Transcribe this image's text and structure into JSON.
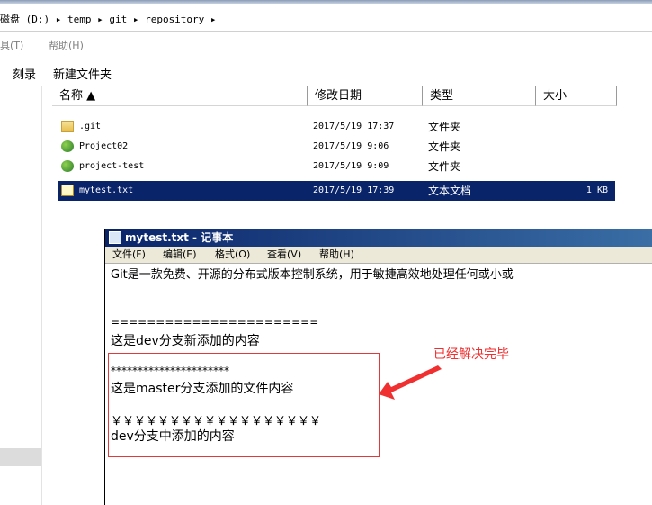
{
  "address_bar": {
    "path": "磁盘 (D:) ▸ temp ▸ git ▸ repository ▸"
  },
  "menu": {
    "tools": "具(T)",
    "help": "帮助(H)"
  },
  "toolbar": {
    "burn": "刻录",
    "new_folder": "新建文件夹"
  },
  "columns": {
    "name": "名称 ▲",
    "modified": "修改日期",
    "type": "类型",
    "size": "大小"
  },
  "files": [
    {
      "name": ".git",
      "modified": "2017/5/19 17:37",
      "type": "文件夹",
      "size": "",
      "icon": "folder-icon"
    },
    {
      "name": "Project02",
      "modified": "2017/5/19 9:06",
      "type": "文件夹",
      "size": "",
      "icon": "git-folder-icon"
    },
    {
      "name": "project-test",
      "modified": "2017/5/19 9:09",
      "type": "文件夹",
      "size": "",
      "icon": "git-folder-icon"
    },
    {
      "name": "mytest.txt",
      "modified": "2017/5/19 17:39",
      "type": "文本文档",
      "size": "1 KB",
      "icon": "text-file-icon",
      "selected": true
    }
  ],
  "notepad": {
    "title": "mytest.txt - 记事本",
    "menu": [
      "文件(F)",
      "编辑(E)",
      "格式(O)",
      "查看(V)",
      "帮助(H)"
    ],
    "lines": [
      "Git是一款免费、开源的分布式版本控制系统，用于敏捷高效地处理任何或小或",
      "",
      "=======================",
      "这是dev分支新添加的内容",
      "",
      "**********************",
      "这是master分支添加的文件内容",
      "",
      "￥￥￥￥￥￥￥￥￥￥￥￥￥￥￥￥￥￥",
      "dev分支中添加的内容"
    ]
  },
  "annotation": {
    "text": "已经解决完毕",
    "color": "#f03030"
  },
  "colors": {
    "selection": "#0a246a",
    "title_bar": "#0a246a"
  }
}
